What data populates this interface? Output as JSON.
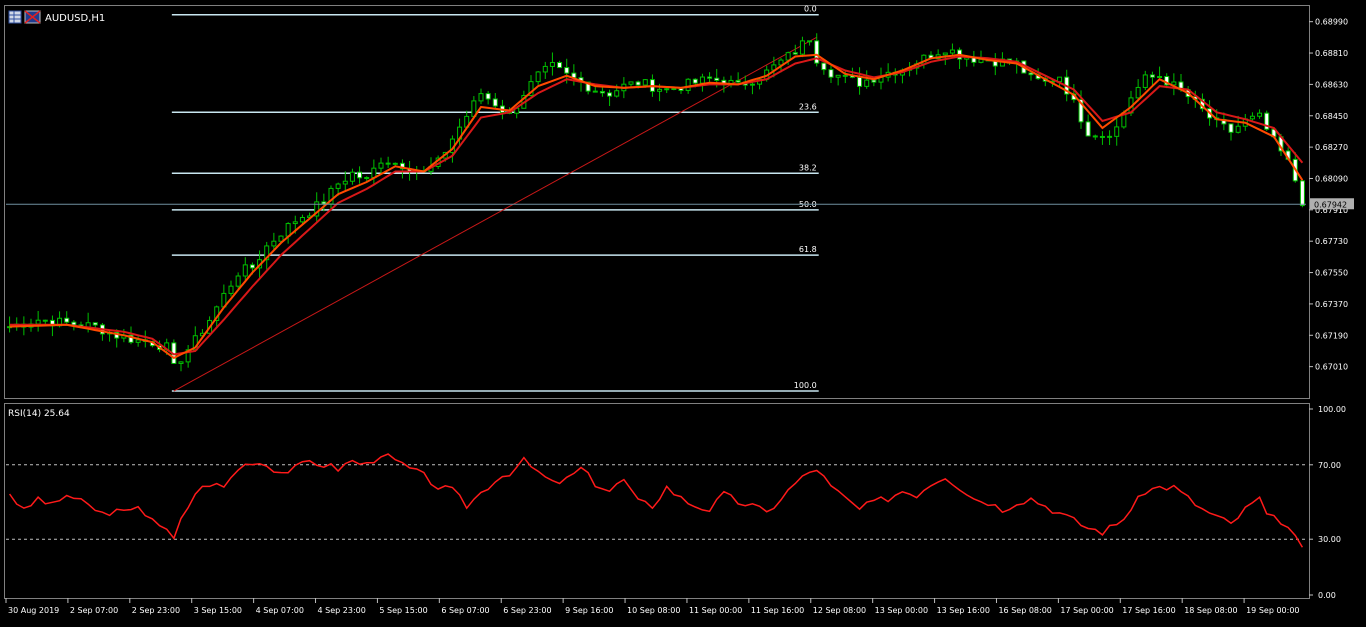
{
  "window": {
    "symbol_label": "AUDUSD,H1"
  },
  "colors": {
    "background": "#000000",
    "candle": "#00c000",
    "ma_fast": "#ff4a00",
    "ma_slow": "#d81818",
    "fib": "#c8e6f0",
    "trendline": "#c81818",
    "rsi": "#ff1a1a",
    "axis_text": "#ffffff",
    "axis_line": "#c0c0c0"
  },
  "chart_data": [
    {
      "type": "candlestick",
      "name": "price",
      "symbol": "AUDUSD",
      "timeframe": "H1",
      "ylim": [
        0.6683,
        0.6908
      ],
      "y_ticks": [
        "0.68990",
        "0.68810",
        "0.68630",
        "0.68450",
        "0.68270",
        "0.68090",
        "0.67910",
        "0.67730",
        "0.67550",
        "0.67370",
        "0.67190",
        "0.67010"
      ],
      "current_price": "0.67942",
      "x_ticks": [
        "30 Aug 2019",
        "2 Sep 07:00",
        "2 Sep 23:00",
        "3 Sep 15:00",
        "4 Sep 07:00",
        "4 Sep 23:00",
        "5 Sep 15:00",
        "6 Sep 07:00",
        "6 Sep 23:00",
        "9 Sep 16:00",
        "10 Sep 08:00",
        "11 Sep 00:00",
        "11 Sep 16:00",
        "12 Sep 08:00",
        "13 Sep 00:00",
        "13 Sep 16:00",
        "16 Sep 08:00",
        "17 Sep 00:00",
        "17 Sep 16:00",
        "18 Sep 08:00",
        "19 Sep 00:00"
      ],
      "close_path": [
        [
          0,
          0.6724
        ],
        [
          4,
          0.6728
        ],
        [
          8,
          0.6726
        ],
        [
          12,
          0.6724
        ],
        [
          15,
          0.6719
        ],
        [
          18,
          0.6716
        ],
        [
          20,
          0.6715
        ],
        [
          22,
          0.6712
        ],
        [
          23,
          0.67
        ],
        [
          24,
          0.6706
        ],
        [
          26,
          0.6716
        ],
        [
          28,
          0.6728
        ],
        [
          30,
          0.6742
        ],
        [
          32,
          0.6755
        ],
        [
          34,
          0.6758
        ],
        [
          36,
          0.677
        ],
        [
          38,
          0.6778
        ],
        [
          40,
          0.6785
        ],
        [
          42,
          0.679
        ],
        [
          44,
          0.6796
        ],
        [
          46,
          0.6806
        ],
        [
          48,
          0.6812
        ],
        [
          50,
          0.6808
        ],
        [
          52,
          0.682
        ],
        [
          54,
          0.6818
        ],
        [
          56,
          0.6816
        ],
        [
          58,
          0.6812
        ],
        [
          60,
          0.6818
        ],
        [
          62,
          0.6832
        ],
        [
          64,
          0.6845
        ],
        [
          66,
          0.6858
        ],
        [
          68,
          0.6852
        ],
        [
          70,
          0.6845
        ],
        [
          72,
          0.6858
        ],
        [
          74,
          0.6868
        ],
        [
          76,
          0.6873
        ],
        [
          78,
          0.6868
        ],
        [
          80,
          0.6864
        ],
        [
          82,
          0.686
        ],
        [
          84,
          0.6858
        ],
        [
          86,
          0.6862
        ],
        [
          88,
          0.6864
        ],
        [
          90,
          0.6862
        ],
        [
          92,
          0.686
        ],
        [
          94,
          0.6862
        ],
        [
          96,
          0.6864
        ],
        [
          98,
          0.6866
        ],
        [
          100,
          0.6865
        ],
        [
          102,
          0.6862
        ],
        [
          104,
          0.6866
        ],
        [
          106,
          0.687
        ],
        [
          108,
          0.6876
        ],
        [
          110,
          0.6882
        ],
        [
          112,
          0.689
        ],
        [
          113,
          0.6878
        ],
        [
          115,
          0.687
        ],
        [
          117,
          0.6866
        ],
        [
          119,
          0.6864
        ],
        [
          121,
          0.6867
        ],
        [
          123,
          0.687
        ],
        [
          125,
          0.6872
        ],
        [
          127,
          0.6876
        ],
        [
          129,
          0.688
        ],
        [
          131,
          0.6884
        ],
        [
          133,
          0.688
        ],
        [
          135,
          0.6878
        ],
        [
          137,
          0.6877
        ],
        [
          139,
          0.6876
        ],
        [
          141,
          0.6875
        ],
        [
          143,
          0.6866
        ],
        [
          145,
          0.6864
        ],
        [
          147,
          0.6868
        ],
        [
          149,
          0.6852
        ],
        [
          151,
          0.6836
        ],
        [
          153,
          0.6834
        ],
        [
          155,
          0.6838
        ],
        [
          157,
          0.6856
        ],
        [
          159,
          0.6866
        ],
        [
          161,
          0.6868
        ],
        [
          163,
          0.6862
        ],
        [
          165,
          0.6856
        ],
        [
          167,
          0.6848
        ],
        [
          169,
          0.684
        ],
        [
          171,
          0.6836
        ],
        [
          173,
          0.6842
        ],
        [
          175,
          0.6844
        ],
        [
          177,
          0.683
        ],
        [
          179,
          0.6818
        ],
        [
          180,
          0.6808
        ],
        [
          181,
          0.6796
        ]
      ],
      "ma_fast": [
        [
          0,
          0.6724
        ],
        [
          8,
          0.6725
        ],
        [
          16,
          0.6719
        ],
        [
          20,
          0.6715
        ],
        [
          23,
          0.6706
        ],
        [
          26,
          0.6712
        ],
        [
          30,
          0.6735
        ],
        [
          34,
          0.6755
        ],
        [
          38,
          0.6772
        ],
        [
          42,
          0.6786
        ],
        [
          46,
          0.68
        ],
        [
          50,
          0.6807
        ],
        [
          54,
          0.6816
        ],
        [
          58,
          0.6813
        ],
        [
          62,
          0.6826
        ],
        [
          66,
          0.685
        ],
        [
          70,
          0.6848
        ],
        [
          74,
          0.6862
        ],
        [
          78,
          0.6868
        ],
        [
          82,
          0.6862
        ],
        [
          86,
          0.6861
        ],
        [
          90,
          0.6862
        ],
        [
          94,
          0.6861
        ],
        [
          98,
          0.6864
        ],
        [
          102,
          0.6863
        ],
        [
          106,
          0.6868
        ],
        [
          110,
          0.6879
        ],
        [
          113,
          0.688
        ],
        [
          117,
          0.6869
        ],
        [
          121,
          0.6866
        ],
        [
          125,
          0.6871
        ],
        [
          129,
          0.6878
        ],
        [
          133,
          0.688
        ],
        [
          137,
          0.6877
        ],
        [
          141,
          0.6875
        ],
        [
          145,
          0.6866
        ],
        [
          149,
          0.6857
        ],
        [
          153,
          0.6838
        ],
        [
          157,
          0.685
        ],
        [
          161,
          0.6866
        ],
        [
          165,
          0.6858
        ],
        [
          169,
          0.6843
        ],
        [
          173,
          0.6841
        ],
        [
          177,
          0.6833
        ],
        [
          181,
          0.6808
        ]
      ],
      "ma_slow": [
        [
          0,
          0.6725
        ],
        [
          8,
          0.6725
        ],
        [
          16,
          0.6721
        ],
        [
          20,
          0.6717
        ],
        [
          23,
          0.6708
        ],
        [
          26,
          0.671
        ],
        [
          30,
          0.6728
        ],
        [
          34,
          0.6747
        ],
        [
          38,
          0.6765
        ],
        [
          42,
          0.678
        ],
        [
          46,
          0.6795
        ],
        [
          50,
          0.6803
        ],
        [
          54,
          0.6813
        ],
        [
          58,
          0.6813
        ],
        [
          62,
          0.6822
        ],
        [
          66,
          0.6844
        ],
        [
          70,
          0.6847
        ],
        [
          74,
          0.6858
        ],
        [
          78,
          0.6866
        ],
        [
          82,
          0.6863
        ],
        [
          86,
          0.6861
        ],
        [
          90,
          0.6862
        ],
        [
          94,
          0.6861
        ],
        [
          98,
          0.6863
        ],
        [
          102,
          0.6863
        ],
        [
          106,
          0.6866
        ],
        [
          110,
          0.6875
        ],
        [
          113,
          0.6878
        ],
        [
          117,
          0.6871
        ],
        [
          121,
          0.6867
        ],
        [
          125,
          0.687
        ],
        [
          129,
          0.6876
        ],
        [
          133,
          0.6879
        ],
        [
          137,
          0.6878
        ],
        [
          141,
          0.6876
        ],
        [
          145,
          0.6868
        ],
        [
          149,
          0.686
        ],
        [
          153,
          0.6842
        ],
        [
          157,
          0.6847
        ],
        [
          161,
          0.6862
        ],
        [
          165,
          0.686
        ],
        [
          169,
          0.6847
        ],
        [
          173,
          0.6843
        ],
        [
          177,
          0.6838
        ],
        [
          181,
          0.6818
        ]
      ],
      "fibonacci": {
        "levels": [
          {
            "label": "0.0",
            "price": 0.6903
          },
          {
            "label": "23.6",
            "price": 0.6847
          },
          {
            "label": "38.2",
            "price": 0.6812
          },
          {
            "label": "50.0",
            "price": 0.6791
          },
          {
            "label": "61.8",
            "price": 0.6765
          },
          {
            "label": "100.0",
            "price": 0.6687
          }
        ],
        "start_index": 23,
        "end_index": 113
      },
      "trendline": {
        "from": [
          23,
          0.6687
        ],
        "to": [
          113,
          0.689
        ]
      }
    },
    {
      "type": "line",
      "name": "RSI",
      "indicator_label": "RSI(14) 25.64",
      "ylim": [
        0,
        100
      ],
      "y_ticks": [
        "100.00",
        "70.00",
        "30.00",
        "0.00"
      ],
      "levels": [
        70,
        30
      ],
      "values": [
        [
          0,
          55
        ],
        [
          2,
          45
        ],
        [
          4,
          52
        ],
        [
          6,
          48
        ],
        [
          8,
          54
        ],
        [
          10,
          50
        ],
        [
          12,
          46
        ],
        [
          14,
          42
        ],
        [
          15,
          48
        ],
        [
          16,
          44
        ],
        [
          18,
          46
        ],
        [
          20,
          42
        ],
        [
          21,
          38
        ],
        [
          22,
          34
        ],
        [
          23,
          30
        ],
        [
          24,
          40
        ],
        [
          26,
          55
        ],
        [
          28,
          60
        ],
        [
          30,
          58
        ],
        [
          32,
          68
        ],
        [
          34,
          72
        ],
        [
          36,
          70
        ],
        [
          38,
          66
        ],
        [
          40,
          68
        ],
        [
          42,
          72
        ],
        [
          44,
          70
        ],
        [
          46,
          68
        ],
        [
          48,
          72
        ],
        [
          50,
          70
        ],
        [
          52,
          76
        ],
        [
          54,
          72
        ],
        [
          56,
          68
        ],
        [
          58,
          64
        ],
        [
          60,
          58
        ],
        [
          62,
          56
        ],
        [
          64,
          48
        ],
        [
          66,
          55
        ],
        [
          68,
          62
        ],
        [
          70,
          66
        ],
        [
          72,
          72
        ],
        [
          74,
          66
        ],
        [
          76,
          60
        ],
        [
          78,
          62
        ],
        [
          80,
          68
        ],
        [
          82,
          60
        ],
        [
          84,
          56
        ],
        [
          86,
          62
        ],
        [
          88,
          50
        ],
        [
          90,
          48
        ],
        [
          92,
          58
        ],
        [
          94,
          52
        ],
        [
          96,
          48
        ],
        [
          98,
          46
        ],
        [
          100,
          54
        ],
        [
          102,
          50
        ],
        [
          104,
          48
        ],
        [
          106,
          44
        ],
        [
          108,
          52
        ],
        [
          110,
          60
        ],
        [
          112,
          66
        ],
        [
          113,
          68
        ],
        [
          115,
          58
        ],
        [
          117,
          52
        ],
        [
          119,
          46
        ],
        [
          121,
          50
        ],
        [
          123,
          52
        ],
        [
          125,
          56
        ],
        [
          127,
          54
        ],
        [
          129,
          60
        ],
        [
          131,
          64
        ],
        [
          133,
          58
        ],
        [
          135,
          52
        ],
        [
          137,
          50
        ],
        [
          139,
          46
        ],
        [
          141,
          50
        ],
        [
          143,
          52
        ],
        [
          145,
          48
        ],
        [
          147,
          44
        ],
        [
          149,
          40
        ],
        [
          151,
          36
        ],
        [
          153,
          34
        ],
        [
          155,
          38
        ],
        [
          157,
          46
        ],
        [
          159,
          56
        ],
        [
          161,
          58
        ],
        [
          163,
          58
        ],
        [
          165,
          52
        ],
        [
          167,
          46
        ],
        [
          169,
          42
        ],
        [
          171,
          38
        ],
        [
          173,
          46
        ],
        [
          175,
          52
        ],
        [
          176,
          42
        ],
        [
          178,
          40
        ],
        [
          180,
          32
        ],
        [
          181,
          25.64
        ]
      ]
    }
  ]
}
